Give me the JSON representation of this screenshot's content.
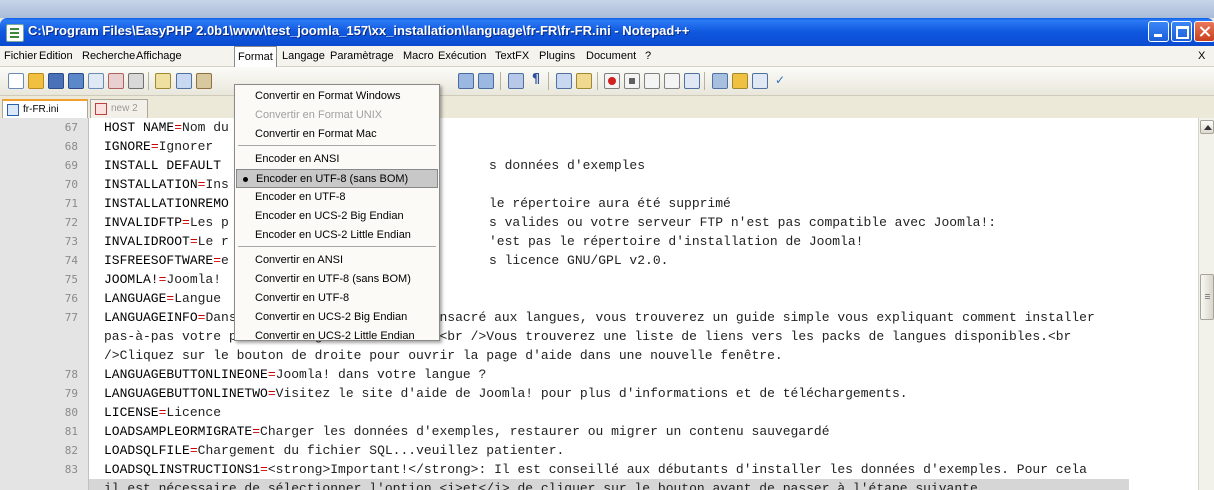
{
  "window": {
    "title": "C:\\Program Files\\EasyPHP 2.0b1\\www\\test_joomla_157\\xx_installation\\language\\fr-FR\\fr-FR.ini - Notepad++"
  },
  "menu": {
    "items": [
      "Fichier",
      "Edition",
      "Recherche",
      "Affichage",
      "Format",
      "Langage",
      "Paramètrage",
      "Macro",
      "Exécution",
      "TextFX",
      "Plugins",
      "Document",
      "?"
    ],
    "close_x": "X",
    "active": "Format"
  },
  "tabs": [
    {
      "label": "fr-FR.ini",
      "active": true
    },
    {
      "label": "new 2",
      "active": false
    }
  ],
  "format_menu": {
    "items": [
      {
        "label": "Convertir en Format Windows",
        "disabled": false,
        "checked": false,
        "highlighted": false
      },
      {
        "label": "Convertir en Format UNIX",
        "disabled": true,
        "checked": false,
        "highlighted": false
      },
      {
        "label": "Convertir en Format Mac",
        "disabled": false,
        "checked": false,
        "highlighted": false
      },
      {
        "label": "Encoder en ANSI",
        "disabled": false,
        "checked": false,
        "highlighted": false
      },
      {
        "label": "Encoder en UTF-8 (sans BOM)",
        "disabled": false,
        "checked": true,
        "highlighted": true
      },
      {
        "label": "Encoder en UTF-8",
        "disabled": false,
        "checked": false,
        "highlighted": false
      },
      {
        "label": "Encoder en UCS-2 Big Endian",
        "disabled": false,
        "checked": false,
        "highlighted": false
      },
      {
        "label": "Encoder en UCS-2 Little Endian",
        "disabled": false,
        "checked": false,
        "highlighted": false
      },
      {
        "label": "Convertir en ANSI",
        "disabled": false,
        "checked": false,
        "highlighted": false
      },
      {
        "label": "Convertir en UTF-8 (sans BOM)",
        "disabled": false,
        "checked": false,
        "highlighted": false
      },
      {
        "label": "Convertir en UTF-8",
        "disabled": false,
        "checked": false,
        "highlighted": false
      },
      {
        "label": "Convertir en UCS-2 Big Endian",
        "disabled": false,
        "checked": false,
        "highlighted": false
      },
      {
        "label": "Convertir en UCS-2 Little Endian",
        "disabled": false,
        "checked": false,
        "highlighted": false
      }
    ]
  },
  "editor": {
    "lines": [
      {
        "num": "67",
        "key": "HOST NAME",
        "value": "Nom du",
        "tail": ""
      },
      {
        "num": "68",
        "key": "IGNORE",
        "value": "Ignorer",
        "tail": ""
      },
      {
        "num": "69",
        "key": "INSTALL DEFAULT",
        "value": "",
        "tail": "s données d'exemples",
        "noeq": true
      },
      {
        "num": "70",
        "key": "INSTALLATION",
        "value": "Ins",
        "tail": ""
      },
      {
        "num": "71",
        "key": "INSTALLATIONREMO",
        "value": "",
        "tail": "le répertoire aura été supprimé",
        "noeq": true
      },
      {
        "num": "72",
        "key": "INVALIDFTP",
        "value": "Les p",
        "tail": "s valides ou votre serveur FTP n'est pas compatible avec Joomla!:"
      },
      {
        "num": "73",
        "key": "INVALIDROOT",
        "value": "Le r",
        "tail": "'est pas le répertoire d'installation de Joomla!"
      },
      {
        "num": "74",
        "key": "ISFREESOFTWARE",
        "value": "e",
        "tail": "s licence GNU/GPL v2.0."
      },
      {
        "num": "75",
        "key": "JOOMLA!",
        "value": "Joomla!",
        "tail": ""
      },
      {
        "num": "76",
        "key": "LANGUAGE",
        "value": "Langue",
        "tail": ""
      },
      {
        "num": "77",
        "key": "LANGUAGEINFO",
        "value": "Dans le site d'aide Joomla! consacré aux langues, vous trouverez un guide simple vous expliquant comment installer",
        "tail": ""
      },
      {
        "num": "",
        "key": "",
        "value": "pas-à-pas votre pack de langue dans Joomla!<br />Vous trouverez une liste de liens vers les packs de langues disponibles.<br",
        "tail": "",
        "cont": true
      },
      {
        "num": "",
        "key": "",
        "value": "/>Cliquez sur le bouton de droite pour ouvrir la page d'aide dans une nouvelle fenêtre.",
        "tail": "",
        "cont": true
      },
      {
        "num": "78",
        "key": "LANGUAGEBUTTONLINEONE",
        "value": "Joomla! dans votre langue ?",
        "tail": ""
      },
      {
        "num": "79",
        "key": "LANGUAGEBUTTONLINETWO",
        "value": "Visitez le site d'aide de Joomla! pour plus d'informations et de téléchargements.",
        "tail": ""
      },
      {
        "num": "80",
        "key": "LICENSE",
        "value": "Licence",
        "tail": ""
      },
      {
        "num": "81",
        "key": "LOADSAMPLEORMIGRATE",
        "value": "Charger les données d'exemples, restaurer ou migrer un contenu sauvegardé",
        "tail": ""
      },
      {
        "num": "82",
        "key": "LOADSQLFILE",
        "value": "Chargement du fichier SQL...veuillez patienter.",
        "tail": ""
      },
      {
        "num": "83",
        "key": "LOADSQLINSTRUCTIONS1",
        "value": "<strong>Important!</strong>: Il est conseillé aux débutants d'installer les données d'exemples. Pour cela",
        "tail": ""
      },
      {
        "num": "",
        "key": "",
        "value": "il est nécessaire de sélectionner l'option <i>et</i> de cliquer sur le bouton avant de passer à l'étape suivante.",
        "tail": "",
        "cont": true
      }
    ]
  }
}
